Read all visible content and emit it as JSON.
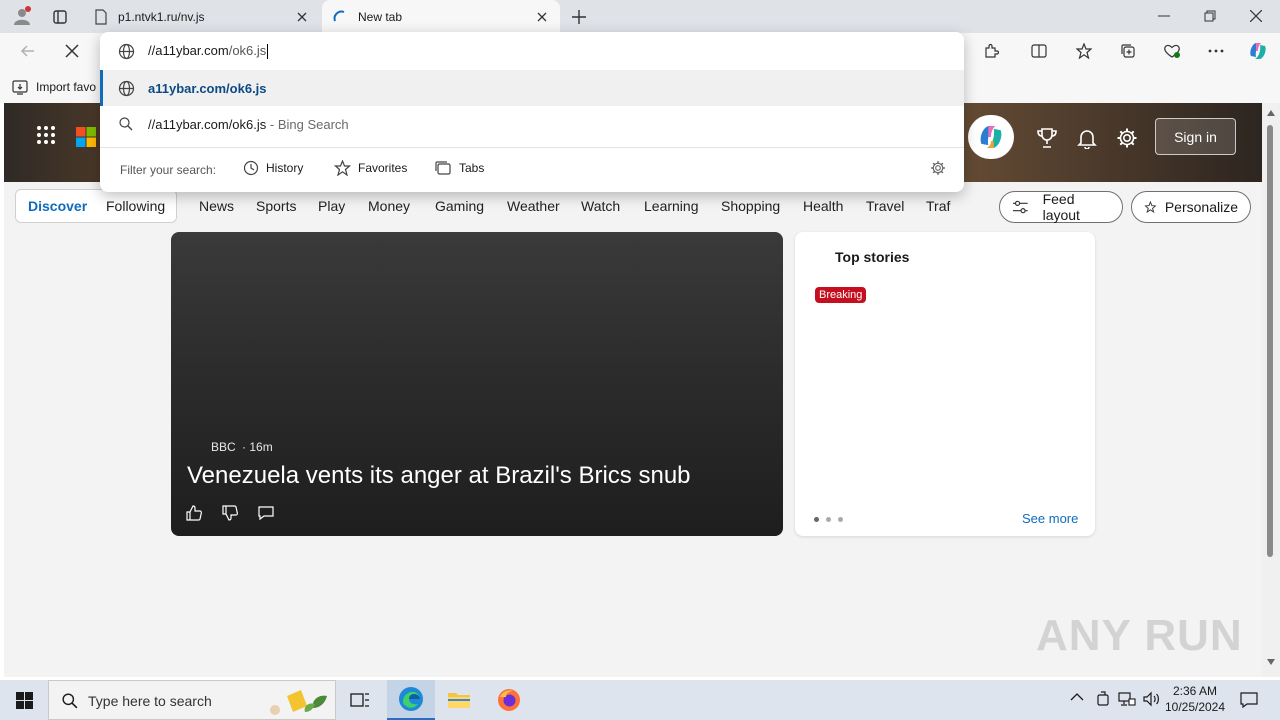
{
  "tabs": [
    {
      "label": "p1.ntvk1.ru/nv.js"
    },
    {
      "label": "New tab"
    }
  ],
  "address": {
    "value_bold": "//a11ybar.com",
    "value_rest": "/ok6.js"
  },
  "omnibox": {
    "suggestion_url": "a11ybar.com/ok6.js",
    "search_query": "//a11ybar.com/ok6.js",
    "search_suffix": " - Bing Search",
    "filter_label": "Filter your search:",
    "filters": [
      "History",
      "Favorites",
      "Tabs"
    ]
  },
  "favorites_bar": {
    "import_label": "Import favo"
  },
  "header": {
    "sign_in": "Sign in"
  },
  "nav": {
    "discover": "Discover",
    "following": "Following",
    "links": [
      "News",
      "Sports",
      "Play",
      "Money",
      "Gaming",
      "Weather",
      "Watch",
      "Learning",
      "Shopping",
      "Health",
      "Travel",
      "Traf"
    ],
    "feed_layout": "Feed layout",
    "personalize": "Personalize"
  },
  "hero": {
    "source": "BBC",
    "time": "· 16m",
    "headline": "Venezuela vents its anger at Brazil's Brics snub"
  },
  "top_stories": {
    "title": "Top stories",
    "badge": "Breaking",
    "see_more": "See more"
  },
  "watermark": "ANY RUN",
  "taskbar": {
    "search_placeholder": "Type here to search",
    "time": "2:36 AM",
    "date": "10/25/2024"
  },
  "colors": {
    "accent": "#0f6cbd",
    "breaking": "#c50f1f"
  }
}
